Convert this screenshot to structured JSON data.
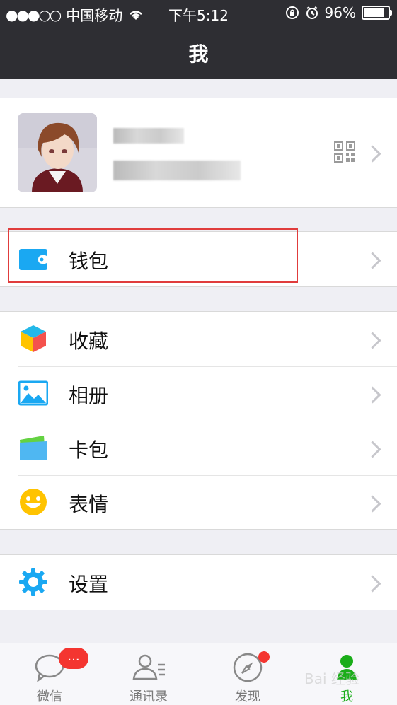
{
  "status_bar": {
    "signal": "●●●○○",
    "carrier": "中国移动",
    "time": "下午5:12",
    "battery": "96%",
    "battery_level": 0.96
  },
  "header": {
    "title": "我"
  },
  "profile": {
    "avatar_icon": "user-avatar",
    "qr_icon": "qr-code-icon"
  },
  "menu": {
    "wallet": {
      "label": "钱包",
      "icon": "wallet-icon"
    },
    "favorites": {
      "label": "收藏",
      "icon": "cube-icon"
    },
    "album": {
      "label": "相册",
      "icon": "image-icon"
    },
    "cards": {
      "label": "卡包",
      "icon": "card-icon"
    },
    "stickers": {
      "label": "表情",
      "icon": "smile-icon"
    },
    "settings": {
      "label": "设置",
      "icon": "gear-icon"
    }
  },
  "tabs": [
    {
      "label": "微信",
      "icon": "chat-icon"
    },
    {
      "label": "通讯录",
      "icon": "contacts-icon"
    },
    {
      "label": "发现",
      "icon": "compass-icon"
    },
    {
      "label": "我",
      "icon": "me-icon"
    }
  ],
  "badge_text": "...",
  "watermark": "Bai 经验",
  "colors": {
    "accent_green": "#1aad19",
    "header_bg": "#2e2e33",
    "badge_red": "#f43530",
    "highlight_box": "#e03c3c"
  }
}
